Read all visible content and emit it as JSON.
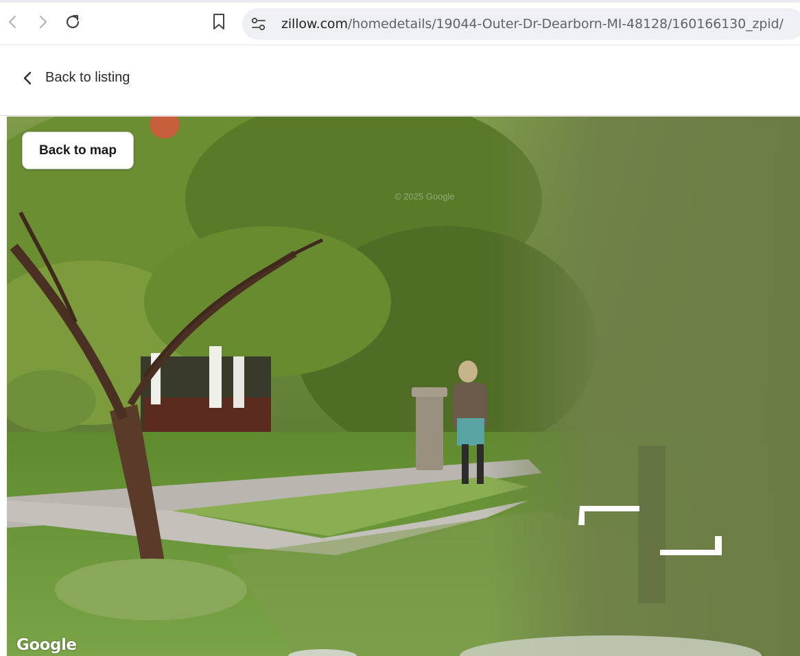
{
  "browser": {
    "url_host": "zillow.com",
    "url_path": "/homedetails/19044-Outer-Dr-Dearborn-MI-48128/160166130_zpid/",
    "icons": [
      "back-arrow-icon",
      "forward-arrow-icon",
      "reload-icon",
      "bookmark-icon",
      "site-settings-icon"
    ]
  },
  "header": {
    "back_label": "Back to listing"
  },
  "streetview": {
    "back_to_map_label": "Back to map",
    "copyright": "© 2025 Google",
    "logo_text": "Google"
  },
  "colors": {
    "foliage": "#5d7a2c",
    "lawn": "#6f9a3a",
    "sidewalk": "#b9b6b0"
  }
}
